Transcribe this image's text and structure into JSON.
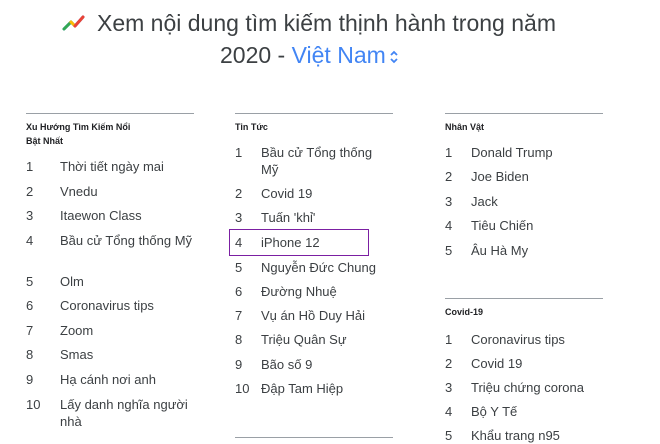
{
  "header": {
    "title_line1": "Xem nội dung tìm kiếm thịnh hành trong năm",
    "title_year": "2020 -",
    "region": "Việt Nam",
    "icon": "google-trends-icon",
    "region_icon": "up-down-chevron-icon"
  },
  "columns": [
    {
      "title": "Xu Hướng Tìm Kiếm Nổi Bật Nhất",
      "items": [
        {
          "rank": "1",
          "label": "Thời tiết ngày mai"
        },
        {
          "rank": "2",
          "label": "Vnedu"
        },
        {
          "rank": "3",
          "label": "Itaewon Class"
        },
        {
          "rank": "4",
          "label": "Bầu cử Tổng thống Mỹ"
        },
        {
          "rank": "5",
          "label": "Olm"
        },
        {
          "rank": "6",
          "label": "Coronavirus tips"
        },
        {
          "rank": "7",
          "label": "Zoom"
        },
        {
          "rank": "8",
          "label": "Smas"
        },
        {
          "rank": "9",
          "label": "Hạ cánh nơi anh"
        },
        {
          "rank": "10",
          "label": "Lấy danh nghĩa người nhà"
        }
      ]
    },
    {
      "title": "Tin Tức",
      "items": [
        {
          "rank": "1",
          "label": "Bầu cử Tổng thống Mỹ"
        },
        {
          "rank": "2",
          "label": "Covid 19"
        },
        {
          "rank": "3",
          "label": "Tuấn 'khỉ'"
        },
        {
          "rank": "4",
          "label": "iPhone 12"
        },
        {
          "rank": "5",
          "label": "Nguyễn Đức Chung"
        },
        {
          "rank": "6",
          "label": "Đường Nhuệ"
        },
        {
          "rank": "7",
          "label": "Vụ án Hồ Duy Hải"
        },
        {
          "rank": "8",
          "label": "Triệu Quân Sự"
        },
        {
          "rank": "9",
          "label": "Bão số 9"
        },
        {
          "rank": "10",
          "label": "Đập Tam Hiệp"
        }
      ]
    },
    {
      "title": "Nhân Vật",
      "items": [
        {
          "rank": "1",
          "label": "Donald Trump"
        },
        {
          "rank": "2",
          "label": "Joe Biden"
        },
        {
          "rank": "3",
          "label": "Jack"
        },
        {
          "rank": "4",
          "label": "Tiêu Chiến"
        },
        {
          "rank": "5",
          "label": "Âu Hà My"
        }
      ]
    },
    {
      "title": "Covid-19",
      "items": [
        {
          "rank": "1",
          "label": "Coronavirus tips"
        },
        {
          "rank": "2",
          "label": "Covid 19"
        },
        {
          "rank": "3",
          "label": "Triệu chứng corona"
        },
        {
          "rank": "4",
          "label": "Bộ Y Tế"
        },
        {
          "rank": "5",
          "label": "Khẩu trang n95"
        }
      ]
    }
  ],
  "colors": {
    "region_link": "#4285f4",
    "highlight_border": "#7b1fa2"
  }
}
